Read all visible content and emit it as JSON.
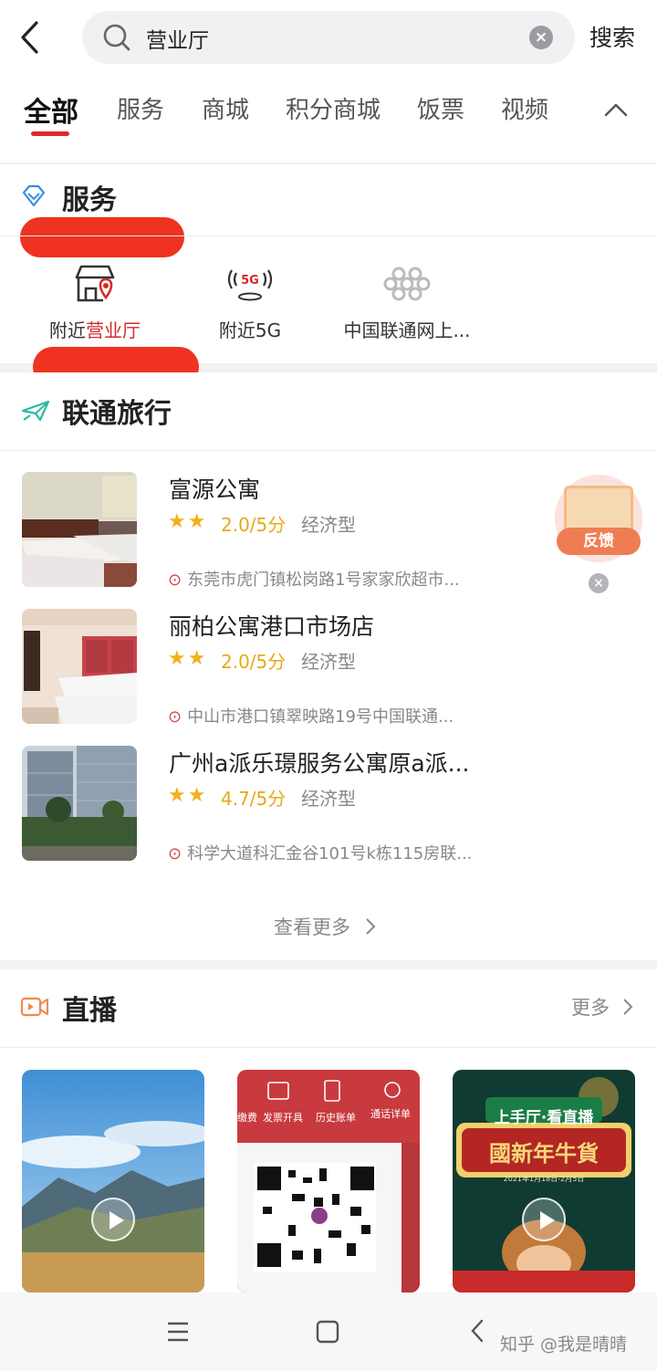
{
  "search": {
    "query": "营业厅",
    "button_label": "搜索"
  },
  "tabs": [
    {
      "label": "全部",
      "active": true
    },
    {
      "label": "服务"
    },
    {
      "label": "商城"
    },
    {
      "label": "积分商城"
    },
    {
      "label": "饭票"
    },
    {
      "label": "视频"
    }
  ],
  "service": {
    "title": "服务",
    "items": [
      {
        "label_prefix": "附近",
        "label_highlight": "营业厅"
      },
      {
        "label": "附近5G",
        "icon_text": "5G"
      },
      {
        "label": "中国联通网上..."
      }
    ]
  },
  "travel": {
    "title": "联通旅行",
    "hotels": [
      {
        "name": "富源公寓",
        "stars": "★★",
        "score": "2.0/5分",
        "type": "经济型",
        "address": "东莞市虎门镇松岗路1号家家欣超市..."
      },
      {
        "name": "丽柏公寓港口市场店",
        "stars": "★★",
        "score": "2.0/5分",
        "type": "经济型",
        "address": "中山市港口镇翠映路19号中国联通..."
      },
      {
        "name": "广州a派乐璟服务公寓原a派...",
        "stars": "★★",
        "score": "4.7/5分",
        "type": "经济型",
        "address": "科学大道科汇金谷101号k栋115房联..."
      }
    ],
    "more_label": "查看更多"
  },
  "feedback": {
    "label": "反馈"
  },
  "live": {
    "title": "直播",
    "more_label": "更多",
    "thumb2_labels": [
      "缴费",
      "发票开具",
      "历史账单",
      "通话详单"
    ],
    "thumb3_banner": "上手厅·看直播",
    "thumb3_title": "國新年牛貨",
    "thumb3_date": "2021年1月18日-2月5日"
  },
  "watermark": "知乎 @我是晴晴",
  "colors": {
    "accent_red": "#e0262c",
    "star": "#f2b01c",
    "redaction": "#ef3320"
  }
}
